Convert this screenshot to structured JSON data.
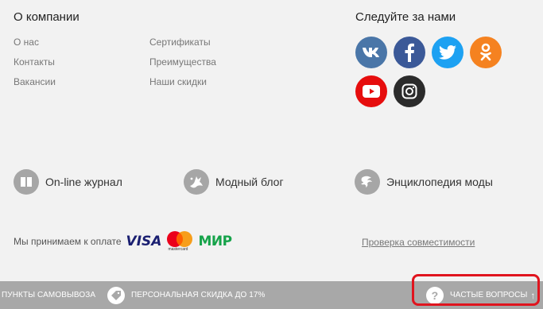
{
  "company": {
    "title": "О компании",
    "col1": [
      "О нас",
      "Контакты",
      "Вакансии"
    ],
    "col2": [
      "Сертификаты",
      "Преимущества",
      "Наши скидки"
    ]
  },
  "social": {
    "title": "Следуйте за нами",
    "items": [
      {
        "name": "vk",
        "color": "#4a76a8"
      },
      {
        "name": "facebook",
        "color": "#3b5998"
      },
      {
        "name": "twitter",
        "color": "#1da1f2"
      },
      {
        "name": "odnoklassniki",
        "color": "#f58220"
      },
      {
        "name": "youtube",
        "color": "#e60d0d"
      },
      {
        "name": "instagram",
        "color": "#2b2b2b"
      }
    ]
  },
  "features": [
    {
      "label": "On-line журнал",
      "icon": "journal-icon"
    },
    {
      "label": "Модный блог",
      "icon": "bird-icon"
    },
    {
      "label": "Энциклопедия моды",
      "icon": "encyclopedia-icon"
    }
  ],
  "payment": {
    "label": "Мы принимаем к оплате",
    "visa": "VISA",
    "mastercard": "mastercard",
    "mir": "МИР"
  },
  "compatibility_link": "Проверка совместимости",
  "bottom_bar": {
    "pickup": "ПУНКТЫ САМОВЫВОЗА",
    "discount": "ПЕРСОНАЛЬНАЯ СКИДКА ДО 17%",
    "faq": "ЧАСТЫЕ ВОПРОСЫ"
  },
  "colors": {
    "background": "#f2f2f2",
    "bar": "#a8a8a8",
    "highlight": "#e0141e"
  }
}
